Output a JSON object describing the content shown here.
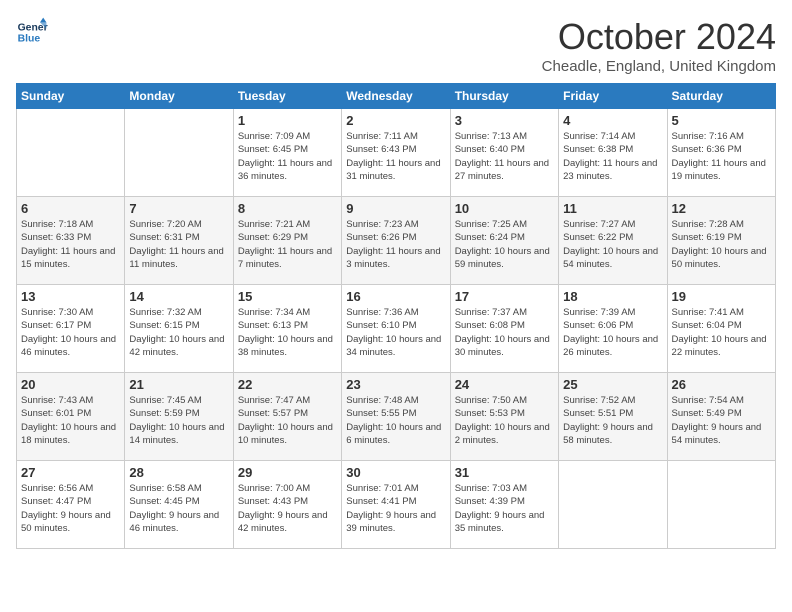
{
  "logo": {
    "line1": "General",
    "line2": "Blue"
  },
  "title": "October 2024",
  "subtitle": "Cheadle, England, United Kingdom",
  "days_of_week": [
    "Sunday",
    "Monday",
    "Tuesday",
    "Wednesday",
    "Thursday",
    "Friday",
    "Saturday"
  ],
  "weeks": [
    [
      {
        "day": "",
        "detail": ""
      },
      {
        "day": "",
        "detail": ""
      },
      {
        "day": "1",
        "detail": "Sunrise: 7:09 AM\nSunset: 6:45 PM\nDaylight: 11 hours and 36 minutes."
      },
      {
        "day": "2",
        "detail": "Sunrise: 7:11 AM\nSunset: 6:43 PM\nDaylight: 11 hours and 31 minutes."
      },
      {
        "day": "3",
        "detail": "Sunrise: 7:13 AM\nSunset: 6:40 PM\nDaylight: 11 hours and 27 minutes."
      },
      {
        "day": "4",
        "detail": "Sunrise: 7:14 AM\nSunset: 6:38 PM\nDaylight: 11 hours and 23 minutes."
      },
      {
        "day": "5",
        "detail": "Sunrise: 7:16 AM\nSunset: 6:36 PM\nDaylight: 11 hours and 19 minutes."
      }
    ],
    [
      {
        "day": "6",
        "detail": "Sunrise: 7:18 AM\nSunset: 6:33 PM\nDaylight: 11 hours and 15 minutes."
      },
      {
        "day": "7",
        "detail": "Sunrise: 7:20 AM\nSunset: 6:31 PM\nDaylight: 11 hours and 11 minutes."
      },
      {
        "day": "8",
        "detail": "Sunrise: 7:21 AM\nSunset: 6:29 PM\nDaylight: 11 hours and 7 minutes."
      },
      {
        "day": "9",
        "detail": "Sunrise: 7:23 AM\nSunset: 6:26 PM\nDaylight: 11 hours and 3 minutes."
      },
      {
        "day": "10",
        "detail": "Sunrise: 7:25 AM\nSunset: 6:24 PM\nDaylight: 10 hours and 59 minutes."
      },
      {
        "day": "11",
        "detail": "Sunrise: 7:27 AM\nSunset: 6:22 PM\nDaylight: 10 hours and 54 minutes."
      },
      {
        "day": "12",
        "detail": "Sunrise: 7:28 AM\nSunset: 6:19 PM\nDaylight: 10 hours and 50 minutes."
      }
    ],
    [
      {
        "day": "13",
        "detail": "Sunrise: 7:30 AM\nSunset: 6:17 PM\nDaylight: 10 hours and 46 minutes."
      },
      {
        "day": "14",
        "detail": "Sunrise: 7:32 AM\nSunset: 6:15 PM\nDaylight: 10 hours and 42 minutes."
      },
      {
        "day": "15",
        "detail": "Sunrise: 7:34 AM\nSunset: 6:13 PM\nDaylight: 10 hours and 38 minutes."
      },
      {
        "day": "16",
        "detail": "Sunrise: 7:36 AM\nSunset: 6:10 PM\nDaylight: 10 hours and 34 minutes."
      },
      {
        "day": "17",
        "detail": "Sunrise: 7:37 AM\nSunset: 6:08 PM\nDaylight: 10 hours and 30 minutes."
      },
      {
        "day": "18",
        "detail": "Sunrise: 7:39 AM\nSunset: 6:06 PM\nDaylight: 10 hours and 26 minutes."
      },
      {
        "day": "19",
        "detail": "Sunrise: 7:41 AM\nSunset: 6:04 PM\nDaylight: 10 hours and 22 minutes."
      }
    ],
    [
      {
        "day": "20",
        "detail": "Sunrise: 7:43 AM\nSunset: 6:01 PM\nDaylight: 10 hours and 18 minutes."
      },
      {
        "day": "21",
        "detail": "Sunrise: 7:45 AM\nSunset: 5:59 PM\nDaylight: 10 hours and 14 minutes."
      },
      {
        "day": "22",
        "detail": "Sunrise: 7:47 AM\nSunset: 5:57 PM\nDaylight: 10 hours and 10 minutes."
      },
      {
        "day": "23",
        "detail": "Sunrise: 7:48 AM\nSunset: 5:55 PM\nDaylight: 10 hours and 6 minutes."
      },
      {
        "day": "24",
        "detail": "Sunrise: 7:50 AM\nSunset: 5:53 PM\nDaylight: 10 hours and 2 minutes."
      },
      {
        "day": "25",
        "detail": "Sunrise: 7:52 AM\nSunset: 5:51 PM\nDaylight: 9 hours and 58 minutes."
      },
      {
        "day": "26",
        "detail": "Sunrise: 7:54 AM\nSunset: 5:49 PM\nDaylight: 9 hours and 54 minutes."
      }
    ],
    [
      {
        "day": "27",
        "detail": "Sunrise: 6:56 AM\nSunset: 4:47 PM\nDaylight: 9 hours and 50 minutes."
      },
      {
        "day": "28",
        "detail": "Sunrise: 6:58 AM\nSunset: 4:45 PM\nDaylight: 9 hours and 46 minutes."
      },
      {
        "day": "29",
        "detail": "Sunrise: 7:00 AM\nSunset: 4:43 PM\nDaylight: 9 hours and 42 minutes."
      },
      {
        "day": "30",
        "detail": "Sunrise: 7:01 AM\nSunset: 4:41 PM\nDaylight: 9 hours and 39 minutes."
      },
      {
        "day": "31",
        "detail": "Sunrise: 7:03 AM\nSunset: 4:39 PM\nDaylight: 9 hours and 35 minutes."
      },
      {
        "day": "",
        "detail": ""
      },
      {
        "day": "",
        "detail": ""
      }
    ]
  ]
}
